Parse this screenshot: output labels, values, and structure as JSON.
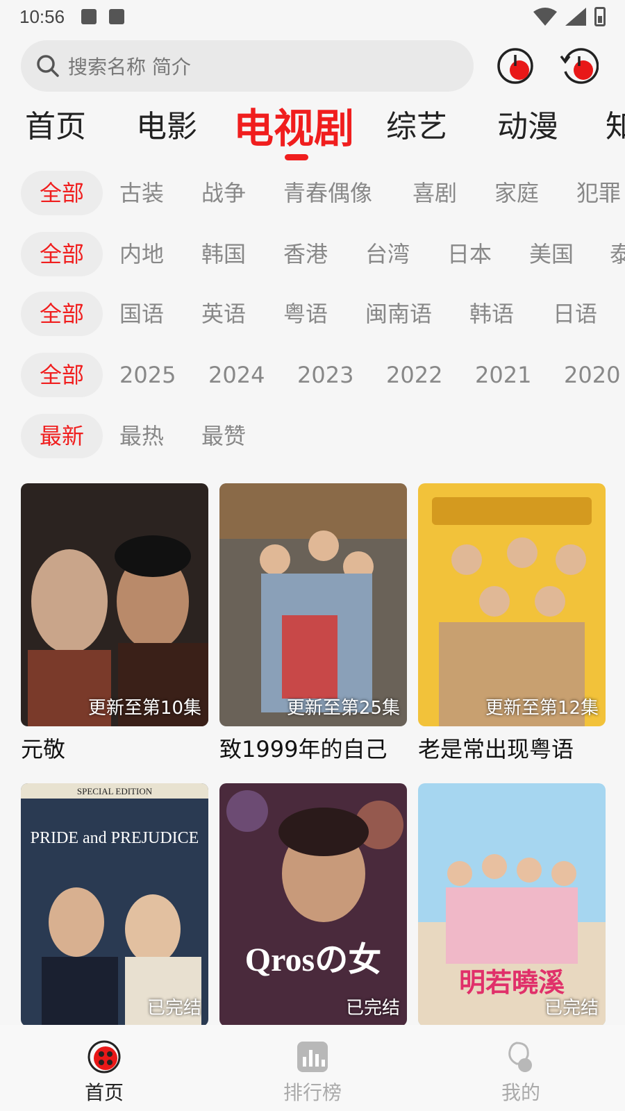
{
  "status_bar": {
    "time": "10:56"
  },
  "search": {
    "placeholder": "搜索名称 简介"
  },
  "main_tabs": [
    "首页",
    "电影",
    "电视剧",
    "综艺",
    "动漫",
    "知"
  ],
  "filters": {
    "genre": [
      "全部",
      "古装",
      "战争",
      "青春偶像",
      "喜剧",
      "家庭",
      "犯罪"
    ],
    "region": [
      "全部",
      "内地",
      "韩国",
      "香港",
      "台湾",
      "日本",
      "美国",
      "泰"
    ],
    "language": [
      "全部",
      "国语",
      "英语",
      "粤语",
      "闽南语",
      "韩语",
      "日语"
    ],
    "year": [
      "全部",
      "2025",
      "2024",
      "2023",
      "2022",
      "2021",
      "2020"
    ],
    "sort": [
      "最新",
      "最热",
      "最赞"
    ]
  },
  "shows": [
    {
      "title": "元敬",
      "badge": "更新至第10集",
      "colors": [
        "#2b2320",
        "#7a3a2a"
      ]
    },
    {
      "title": "致1999年的自己",
      "badge": "更新至第25集",
      "colors": [
        "#6a6258",
        "#3f3a36"
      ]
    },
    {
      "title": "老是常出现粤语",
      "badge": "更新至第12集",
      "colors": [
        "#f2c23a",
        "#d49a1f"
      ]
    },
    {
      "title": "",
      "badge": "已完结",
      "colors": [
        "#2a3a52",
        "#6b88a8"
      ],
      "poster_text": "PRIDE and PREJUDICE",
      "poster_top": "SPECIAL EDITION"
    },
    {
      "title": "",
      "badge": "已完结",
      "colors": [
        "#4a2a3c",
        "#9a5a3a"
      ],
      "poster_text": "Qrosの女"
    },
    {
      "title": "",
      "badge": "已完结",
      "colors": [
        "#a6d6f0",
        "#e8d8c0"
      ],
      "poster_text": "明若曉溪"
    }
  ],
  "bottom_nav": [
    {
      "label": "首页",
      "icon": "home-film-icon",
      "active": true
    },
    {
      "label": "排行榜",
      "icon": "chart-icon",
      "active": false
    },
    {
      "label": "我的",
      "icon": "profile-icon",
      "active": false
    }
  ],
  "colors": {
    "accent": "#f01e1e",
    "chip_bg": "#ececec",
    "inactive": "#888888"
  }
}
